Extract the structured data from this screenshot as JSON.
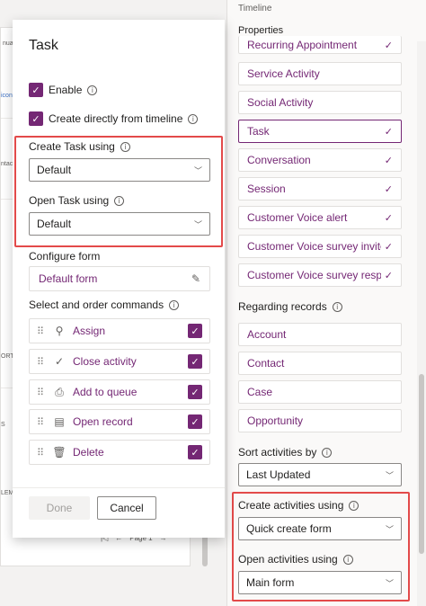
{
  "background": {
    "fragments": [
      "nual I",
      "icon",
      "ntac",
      "ORTI",
      "S",
      "LEM"
    ],
    "pager_first": "|◁",
    "pager_prev": "←",
    "pager_label": "Page 1",
    "pager_next": "→"
  },
  "right_panel": {
    "header": "Timeline",
    "tab": "Properties",
    "activities": [
      {
        "label": "Recurring Appointment",
        "checked": true
      },
      {
        "label": "Service Activity",
        "checked": false
      },
      {
        "label": "Social Activity",
        "checked": false
      },
      {
        "label": "Task",
        "checked": true
      },
      {
        "label": "Conversation",
        "checked": true
      },
      {
        "label": "Session",
        "checked": true
      },
      {
        "label": "Customer Voice alert",
        "checked": true
      },
      {
        "label": "Customer Voice survey invite",
        "checked": true
      },
      {
        "label": "Customer Voice survey response",
        "checked": true
      }
    ],
    "regarding_label": "Regarding records",
    "regarding": [
      "Account",
      "Contact",
      "Case",
      "Opportunity"
    ],
    "sort_label": "Sort activities by",
    "sort_value": "Last Updated",
    "create_label": "Create activities using",
    "create_value": "Quick create form",
    "open_label": "Open activities using",
    "open_value": "Main form"
  },
  "dialog": {
    "title": "Task",
    "enable_label": "Enable",
    "create_timeline_label": "Create directly from timeline",
    "create_task_label": "Create Task using",
    "create_task_value": "Default",
    "open_task_label": "Open Task using",
    "open_task_value": "Default",
    "configure_form_label": "Configure form",
    "default_form": "Default form",
    "commands_label": "Select and order commands",
    "commands": [
      {
        "label": "Assign",
        "icon": "person-icon"
      },
      {
        "label": "Close activity",
        "icon": "check-icon"
      },
      {
        "label": "Add to queue",
        "icon": "queue-icon"
      },
      {
        "label": "Open record",
        "icon": "record-icon"
      },
      {
        "label": "Delete",
        "icon": "trash-icon"
      }
    ],
    "done_label": "Done",
    "cancel_label": "Cancel"
  },
  "colors": {
    "accent": "#742774",
    "highlight": "#e34a4a"
  }
}
